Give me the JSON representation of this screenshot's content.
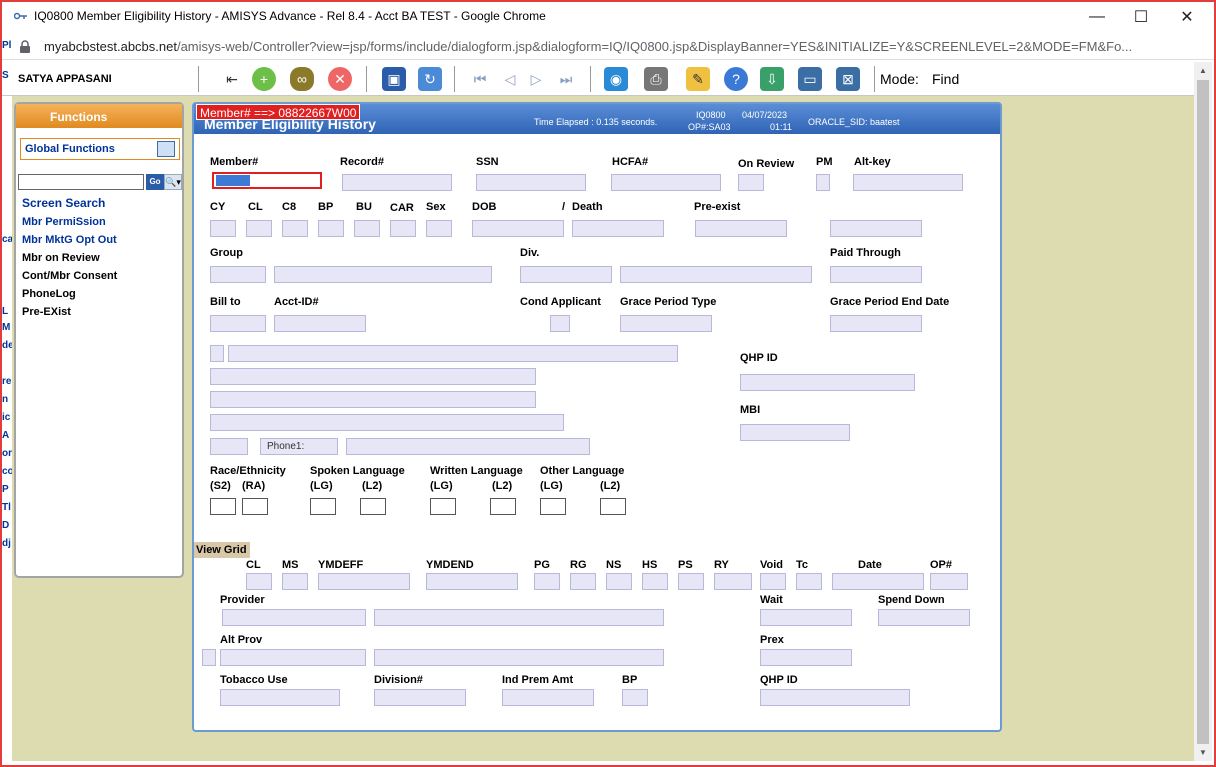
{
  "window": {
    "title": "IQ0800 Member Eligibility History - AMISYS Advance - Rel 8.4 - Acct BA TEST - Google Chrome",
    "url_host": "myabcbstest.abcbs.net",
    "url_path": "/amisys-web/Controller?view=jsp/forms/include/dialogform.jsp&dialogform=IQ/IQ0800.jsp&DisplayBanner=YES&INITIALIZE=Y&SCREENLEVEL=2&MODE=FM&Fo...",
    "minimize": "—",
    "maximize": "☐",
    "close": "✕"
  },
  "toolbar": {
    "username": "SATYA APPASANI",
    "mode_label": "Mode:",
    "mode_value": "Find",
    "icons": [
      "exit-icon",
      "add-icon",
      "binoculars-icon",
      "delete-icon",
      "save-icon",
      "refresh-icon",
      "first-record-icon",
      "previous-record-icon",
      "next-record-icon",
      "last-record-icon",
      "globe-icon",
      "print-icon",
      "notes-icon",
      "help-icon",
      "download-icon",
      "window-icon",
      "close-window-icon"
    ]
  },
  "left_strip": [
    "S",
    "Pl",
    "L",
    "ca",
    "M",
    "de",
    "re",
    "n",
    "ic",
    "A",
    "or",
    "co",
    "P",
    "Tl",
    "D",
    "dj"
  ],
  "functions": {
    "header": "Functions",
    "global": "Global Functions",
    "go": "Go",
    "search_btn": "🔍▾",
    "links": [
      {
        "label": "Screen Search"
      },
      {
        "label": "Mbr PermiSsion"
      },
      {
        "label": "Mbr MktG Opt Out"
      },
      {
        "label": "Mbr on Review"
      },
      {
        "label": "Cont/Mbr Consent"
      },
      {
        "label": "PhoneLog"
      },
      {
        "label": "Pre-EXist"
      }
    ]
  },
  "panel": {
    "title": "Member Eligibility History",
    "banner": "Member# ==> 08822667W00",
    "time_elapsed": "Time Elapsed : 0.135 seconds.",
    "screen": "IQ0800",
    "op": "OP#:SA03",
    "date": "04/07/2023",
    "time": "01:11",
    "oracle_sid": "ORACLE_SID: baatest",
    "labels": {
      "member": "Member#",
      "record": "Record#",
      "ssn": "SSN",
      "hcfa": "HCFA#",
      "on_review": "On Review",
      "pm": "PM",
      "alt_key": "Alt-key",
      "cy": "CY",
      "cl": "CL",
      "c8": "C8",
      "bp": "BP",
      "bu": "BU",
      "car": "CAR",
      "sex": "Sex",
      "dob": "DOB",
      "slash": "/",
      "death": "Death",
      "pre_exist": "Pre-exist",
      "group": "Group",
      "div": "Div.",
      "paid_through": "Paid Through",
      "bill_to": "Bill to",
      "acct_id": "Acct-ID#",
      "cond_applicant": "Cond Applicant",
      "grace_type": "Grace Period Type",
      "grace_end": "Grace Period End Date",
      "qhp_id": "QHP ID",
      "mbi": "MBI",
      "phone1": "Phone1:",
      "race": "Race/Ethnicity",
      "spoken": "Spoken Language",
      "written": "Written Language",
      "other_lang": "Other Language",
      "s2": "(S2)",
      "ra": "(RA)",
      "lg": "(LG)",
      "l2": "(L2)",
      "view_grid": "View Grid",
      "g_cl": "CL",
      "g_ms": "MS",
      "g_ymdeff": "YMDEFF",
      "g_ymdend": "YMDEND",
      "g_pg": "PG",
      "g_rg": "RG",
      "g_ns": "NS",
      "g_hs": "HS",
      "g_ps": "PS",
      "g_ry": "RY",
      "g_void": "Void",
      "g_tc": "Tc",
      "g_date": "Date",
      "g_op": "OP#",
      "provider": "Provider",
      "wait": "Wait",
      "spend_down": "Spend Down",
      "alt_prov": "Alt Prov",
      "prex": "Prex",
      "tobacco": "Tobacco Use",
      "division": "Division#",
      "ind_prem": "Ind Prem Amt",
      "bp2": "BP",
      "qhp_id2": "QHP ID"
    }
  }
}
